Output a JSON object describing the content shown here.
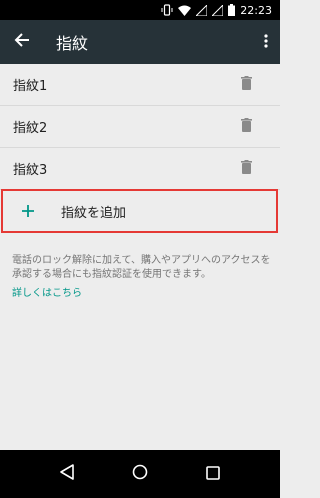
{
  "status_bar": {
    "time": "22:23"
  },
  "app_bar": {
    "title": "指紋"
  },
  "fingerprints": [
    {
      "label": "指紋1"
    },
    {
      "label": "指紋2"
    },
    {
      "label": "指紋3"
    }
  ],
  "add_fingerprint": {
    "label": "指紋を追加"
  },
  "description": "電話のロック解除に加えて、購入やアプリへのアクセスを承認する場合にも指紋認証を使用できます。",
  "learn_more": "詳しくはこちら",
  "colors": {
    "app_bar": "#263238",
    "accent": "#009688",
    "highlight": "#e53935",
    "background": "#ededed"
  },
  "icons": [
    "vibrate-icon",
    "wifi-icon",
    "signal-icon",
    "battery-icon",
    "back-arrow-icon",
    "more-vert-icon",
    "delete-icon",
    "plus-icon",
    "nav-back-icon",
    "nav-home-icon",
    "nav-recents-icon"
  ]
}
